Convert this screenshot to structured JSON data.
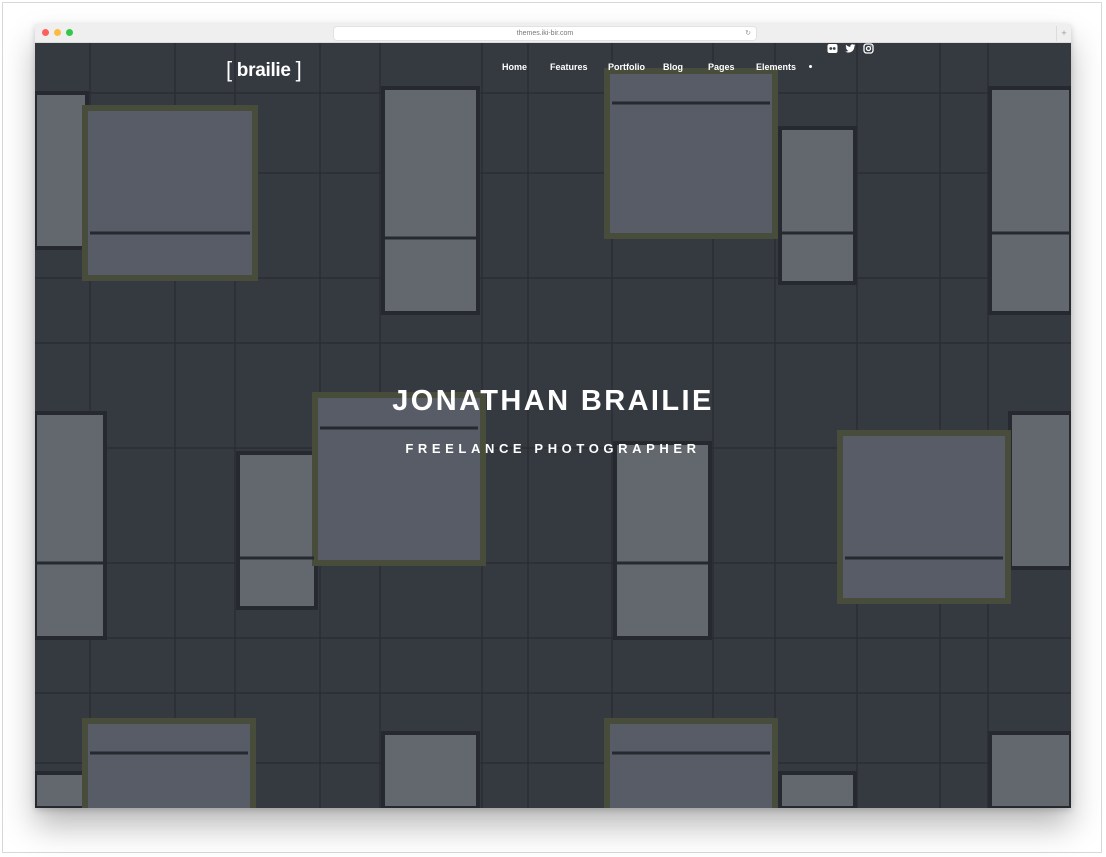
{
  "browser": {
    "url": "themes.iki-bir.com",
    "reload_icon": "reload-icon",
    "new_tab_label": "+"
  },
  "site": {
    "logo_open": "[",
    "logo_text": "brailie",
    "logo_close": "]",
    "nav": [
      {
        "label": "Home"
      },
      {
        "label": "Features"
      },
      {
        "label": "Portfolio"
      },
      {
        "label": "Blog"
      },
      {
        "label": "Pages"
      },
      {
        "label": "Elements"
      }
    ],
    "social_icons": [
      "flickr-icon",
      "twitter-icon",
      "instagram-icon"
    ]
  },
  "hero": {
    "title": "JONATHAN BRAILIE",
    "subtitle": "FREELANCE PHOTOGRAPHER",
    "background_description_color": "#3a3e46"
  },
  "colors": {
    "facade": "#3a3e46",
    "frame": "#4f5340",
    "glass": "#6c7179",
    "text": "#ffffff"
  }
}
